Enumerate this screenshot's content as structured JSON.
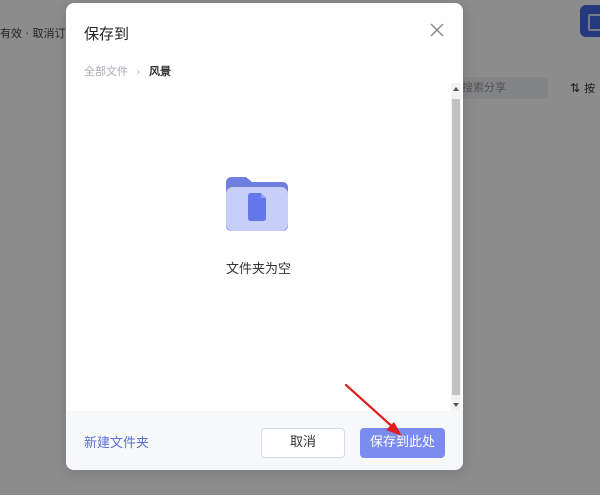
{
  "background": {
    "left_text": "有效 · 取消订阅",
    "search_placeholder": "搜索分享",
    "sort_label": "按"
  },
  "dialog": {
    "title": "保存到",
    "breadcrumb": {
      "root": "全部文件",
      "separator": "›",
      "current": "风景"
    },
    "empty_text": "文件夹为空",
    "footer": {
      "new_folder_label": "新建文件夹",
      "cancel_label": "取消",
      "save_label": "保存到此处"
    }
  },
  "colors": {
    "accent": "#7b8cf0",
    "link": "#5b6fd6",
    "annotation_arrow": "#e02020"
  },
  "icons": [
    "close-icon",
    "empty-folder-icon",
    "sort-icon",
    "annotation-arrow"
  ]
}
